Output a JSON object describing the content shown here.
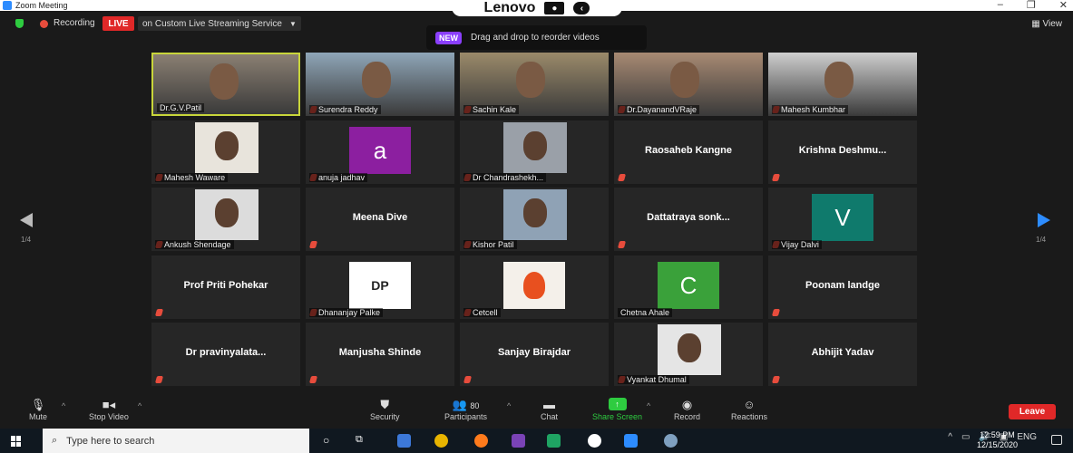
{
  "window": {
    "title": "Zoom Meeting",
    "controls": [
      "–",
      "❐",
      "✕"
    ]
  },
  "overlay": {
    "brand": "Lenovo"
  },
  "topbar": {
    "recording_label": "Recording",
    "live_label": "LIVE",
    "stream_label": "on Custom Live Streaming Service",
    "view_label": "View"
  },
  "reorder_tip": {
    "badge": "NEW",
    "text": "Drag and drop to reorder videos"
  },
  "pager": {
    "left": "1/4",
    "right": "1/4"
  },
  "participants": [
    {
      "name": "Dr.G.V.Patil",
      "kind": "video",
      "color": "#8a7f72",
      "selected": true
    },
    {
      "name": "Surendra Reddy",
      "kind": "video",
      "color": "#8fa6b8"
    },
    {
      "name": "Sachin Kale",
      "kind": "video",
      "color": "#9b8a6a"
    },
    {
      "name": "Dr.DayanandVRaje",
      "kind": "video",
      "color": "#a88a73"
    },
    {
      "name": "Mahesh Kumbhar",
      "kind": "video",
      "color": "#cfcfcf"
    },
    {
      "name": "Mahesh Waware",
      "kind": "photo",
      "color": "#e8e4dc"
    },
    {
      "name": "anuja jadhav",
      "kind": "avatar",
      "letter": "a",
      "color": "#8c1fa0"
    },
    {
      "name": "Dr Chandrashekh...",
      "kind": "photo",
      "color": "#9aa0a8"
    },
    {
      "name": "Raosaheb Kangne",
      "kind": "name"
    },
    {
      "name": "Krishna  Deshmu...",
      "kind": "name"
    },
    {
      "name": "Ankush Shendage",
      "kind": "photo",
      "color": "#dcdcdc"
    },
    {
      "name": "Meena Dive",
      "kind": "name"
    },
    {
      "name": "Kishor Patil",
      "kind": "photo",
      "color": "#8fa2b5"
    },
    {
      "name": "Dattatraya  sonk...",
      "kind": "name"
    },
    {
      "name": "Vijay Dalvi",
      "kind": "avatar",
      "letter": "V",
      "color": "#0f7a6c"
    },
    {
      "name": "Prof Priti Pohekar",
      "kind": "name"
    },
    {
      "name": "Dhananjay Palke",
      "kind": "logo",
      "logo_text": "DP",
      "color": "#ffffff"
    },
    {
      "name": "Cetcell",
      "kind": "logo",
      "logo_text": "",
      "color": "#f4f0ea"
    },
    {
      "name": "Chetna Ahale",
      "kind": "avatar",
      "letter": "C",
      "color": "#3aa13a"
    },
    {
      "name": "Poonam landge",
      "kind": "name"
    },
    {
      "name": "Dr  pravinyalata...",
      "kind": "name"
    },
    {
      "name": "Manjusha Shinde",
      "kind": "name"
    },
    {
      "name": "Sanjay Birajdar",
      "kind": "name"
    },
    {
      "name": "Vyankat Dhumal",
      "kind": "photo",
      "color": "#e5e5e5"
    },
    {
      "name": "Abhijit Yadav",
      "kind": "name"
    }
  ],
  "controls": {
    "mute": "Mute",
    "stop_video": "Stop Video",
    "security": "Security",
    "participants": "Participants",
    "participant_count": "80",
    "chat": "Chat",
    "share": "Share Screen",
    "record": "Record",
    "reactions": "Reactions",
    "leave": "Leave"
  },
  "taskbar": {
    "search_placeholder": "Type here to search",
    "lang": "ENG",
    "time": "12:59 PM",
    "date": "12/15/2020"
  }
}
